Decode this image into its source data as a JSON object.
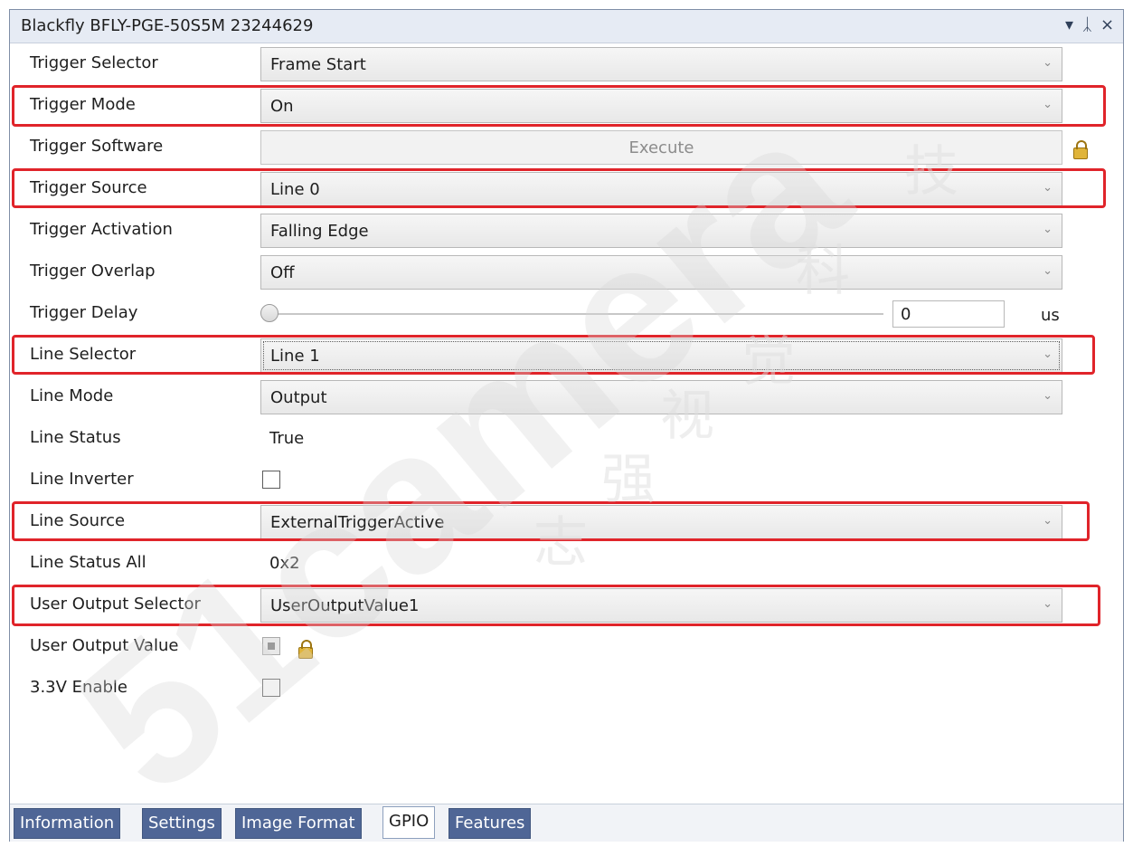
{
  "window": {
    "title": "Blackfly BFLY-PGE-50S5M 23244629",
    "controls": {
      "dropdown": "▾",
      "pin": "ᛣ",
      "close": "×"
    }
  },
  "properties": {
    "trigger_selector": {
      "label": "Trigger Selector",
      "value": "Frame Start"
    },
    "trigger_mode": {
      "label": "Trigger Mode",
      "value": "On"
    },
    "trigger_software": {
      "label": "Trigger Software",
      "value": "Execute"
    },
    "trigger_source": {
      "label": "Trigger Source",
      "value": "Line 0"
    },
    "trigger_activation": {
      "label": "Trigger Activation",
      "value": "Falling Edge"
    },
    "trigger_overlap": {
      "label": "Trigger Overlap",
      "value": "Off"
    },
    "trigger_delay": {
      "label": "Trigger Delay",
      "value": "0",
      "unit": "us",
      "slider_fraction": 0
    },
    "line_selector": {
      "label": "Line Selector",
      "value": "Line 1"
    },
    "line_mode": {
      "label": "Line Mode",
      "value": "Output"
    },
    "line_status": {
      "label": "Line Status",
      "value": "True"
    },
    "line_inverter": {
      "label": "Line Inverter",
      "checked": false
    },
    "line_source": {
      "label": "Line Source",
      "value": "ExternalTriggerActive"
    },
    "line_status_all": {
      "label": "Line Status All",
      "value": "0x2"
    },
    "user_output_selector": {
      "label": "User Output Selector",
      "value": "UserOutputValue1"
    },
    "user_output_value": {
      "label": "User Output Value",
      "checked": "indeterminate",
      "locked": true
    },
    "enable_3v3": {
      "label": "3.3V Enable",
      "checked": false
    }
  },
  "tabs": [
    {
      "label": "Information",
      "active": false
    },
    {
      "label": "Settings",
      "active": false
    },
    {
      "label": "Image Format",
      "active": false
    },
    {
      "label": "GPIO",
      "active": true
    },
    {
      "label": "Features",
      "active": false
    }
  ],
  "highlight_color": "#e0242a",
  "watermark": {
    "text": "51camera",
    "cn_chars": [
      "志",
      "强",
      "视",
      "觉",
      "科",
      "技"
    ]
  }
}
